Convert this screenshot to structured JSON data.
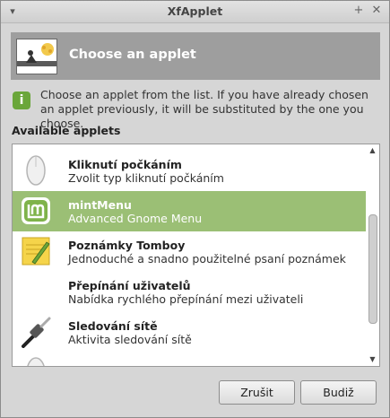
{
  "window": {
    "title": "XfApplet"
  },
  "banner": {
    "title": "Choose an applet"
  },
  "info": {
    "text": "Choose an applet from the list. If you have already chosen an applet previously, it will be substituted by the one you choose."
  },
  "list": {
    "label": "Available applets",
    "items": [
      {
        "name": "Kliknutí počkáním",
        "desc": "Zvolit typ kliknutí počkáním",
        "icon": "mouse-icon",
        "selected": false
      },
      {
        "name": "mintMenu",
        "desc": "Advanced Gnome Menu",
        "icon": "mint-logo-icon",
        "selected": true
      },
      {
        "name": "Poznámky Tomboy",
        "desc": "Jednoduché a snadno použitelné psaní poznámek",
        "icon": "sticky-note-icon",
        "selected": false
      },
      {
        "name": "Přepínání uživatelů",
        "desc": "Nabídka rychlého přepínání mezi uživateli",
        "icon": "user-switch-icon",
        "selected": false
      },
      {
        "name": "Sledování sítě",
        "desc": "Aktivita sledování sítě",
        "icon": "network-cable-icon",
        "selected": false
      }
    ]
  },
  "buttons": {
    "cancel": "Zrušit",
    "ok": "Budiž"
  }
}
